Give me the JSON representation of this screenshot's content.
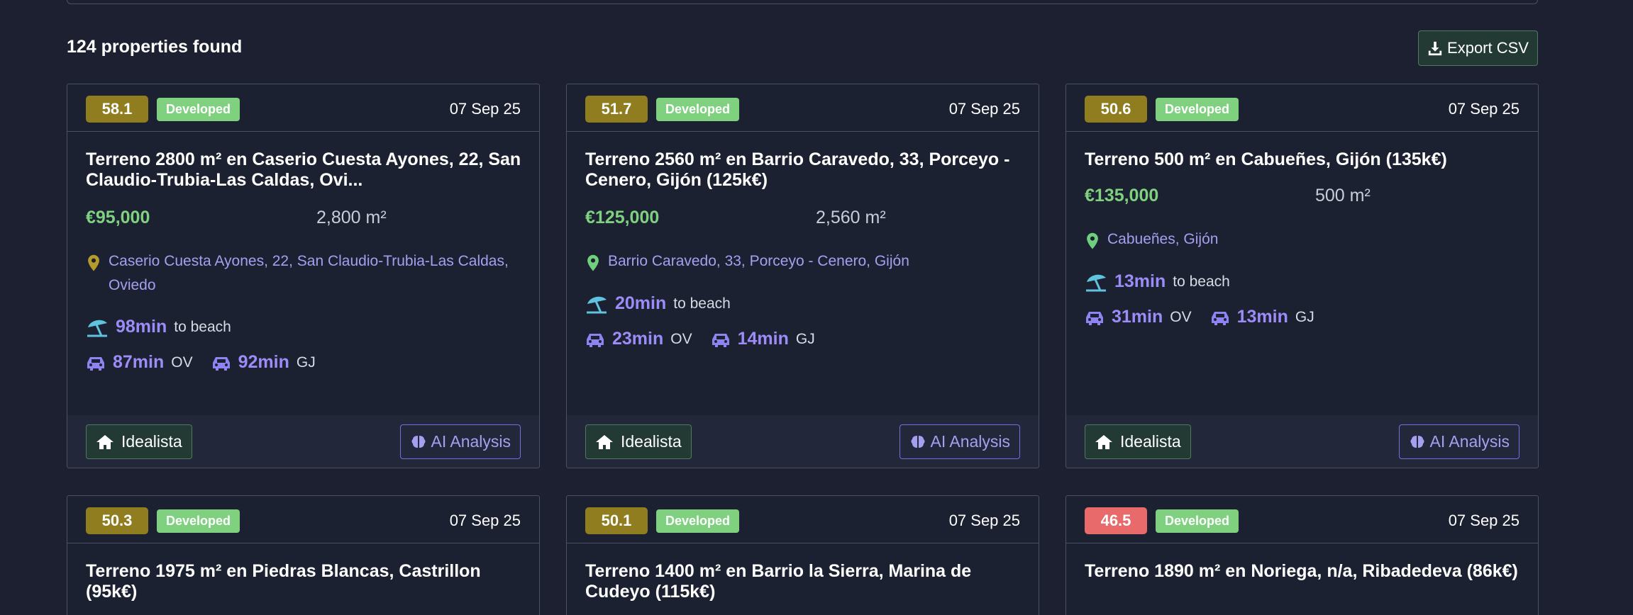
{
  "results": {
    "count_text": "124 properties found"
  },
  "toolbar": {
    "export_label": "Export CSV"
  },
  "colors": {
    "score_olive": "#8f7d1f",
    "score_red": "#e96a6a",
    "accent_green": "#7fd17f",
    "accent_purple": "#9b8cf7",
    "pin_olive": "#b59c2a",
    "pin_green": "#6fcf7f",
    "beach_icon": "#5fc3e0"
  },
  "cards": [
    {
      "score": "58.1",
      "score_color": "olive",
      "status": "Developed",
      "date": "07 Sep 25",
      "title": "Terreno 2800 m² en Caserio Cuesta Ayones, 22, San Claudio-Trubia-Las Caldas, Ovi...",
      "price": "€95,000",
      "area": "2,800 m²",
      "location": "Caserio Cuesta Ayones, 22, San Claudio-Trubia-Las Caldas, Oviedo",
      "pin_color": "olive",
      "beach_time": "98min",
      "beach_label": "to beach",
      "drives": [
        {
          "time": "87min",
          "code": "OV"
        },
        {
          "time": "92min",
          "code": "GJ"
        }
      ],
      "idealista_label": "Idealista",
      "ai_label": "AI Analysis"
    },
    {
      "score": "51.7",
      "score_color": "olive",
      "status": "Developed",
      "date": "07 Sep 25",
      "title": "Terreno 2560 m² en Barrio Caravedo, 33, Porceyo - Cenero, Gijón (125k€)",
      "price": "€125,000",
      "area": "2,560 m²",
      "location": "Barrio Caravedo, 33, Porceyo - Cenero, Gijón",
      "pin_color": "green",
      "beach_time": "20min",
      "beach_label": "to beach",
      "drives": [
        {
          "time": "23min",
          "code": "OV"
        },
        {
          "time": "14min",
          "code": "GJ"
        }
      ],
      "idealista_label": "Idealista",
      "ai_label": "AI Analysis"
    },
    {
      "score": "50.6",
      "score_color": "olive",
      "status": "Developed",
      "date": "07 Sep 25",
      "title": "Terreno 500 m² en Cabueñes, Gijón (135k€)",
      "price": "€135,000",
      "area": "500 m²",
      "location": "Cabueñes, Gijón",
      "pin_color": "green",
      "beach_time": "13min",
      "beach_label": "to beach",
      "drives": [
        {
          "time": "31min",
          "code": "OV"
        },
        {
          "time": "13min",
          "code": "GJ"
        }
      ],
      "idealista_label": "Idealista",
      "ai_label": "AI Analysis"
    },
    {
      "score": "50.3",
      "score_color": "olive",
      "status": "Developed",
      "date": "07 Sep 25",
      "title": "Terreno 1975 m² en Piedras Blancas, Castrillon (95k€)"
    },
    {
      "score": "50.1",
      "score_color": "olive",
      "status": "Developed",
      "date": "07 Sep 25",
      "title": "Terreno 1400 m² en Barrio la Sierra, Marina de Cudeyo (115k€)"
    },
    {
      "score": "46.5",
      "score_color": "red",
      "status": "Developed",
      "date": "07 Sep 25",
      "title": "Terreno 1890 m² en Noriega, n/a, Ribadedeva (86k€)"
    }
  ]
}
